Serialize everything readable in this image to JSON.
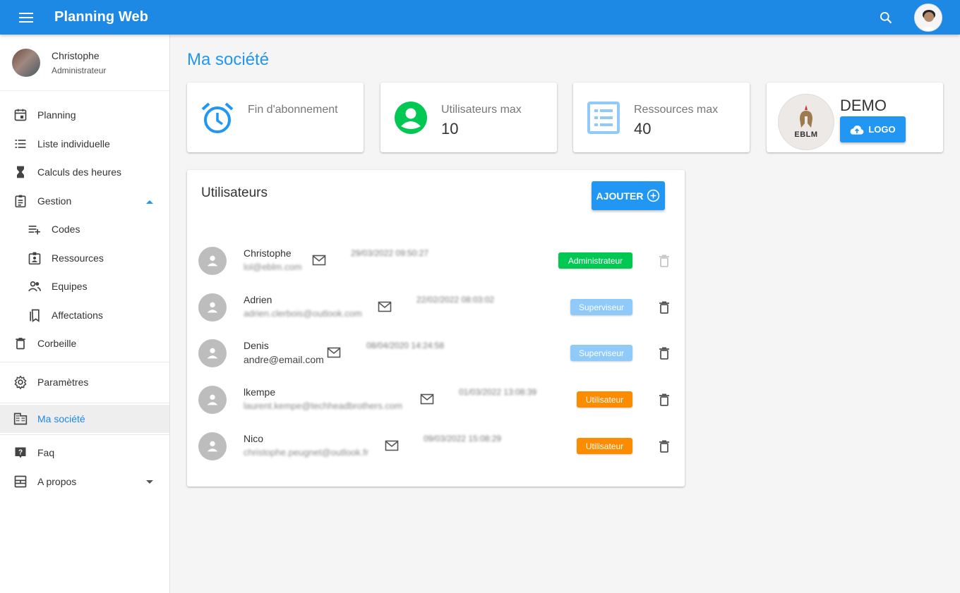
{
  "app": {
    "title": "Planning Web"
  },
  "sidebar": {
    "user": {
      "name": "Christophe",
      "role": "Administrateur"
    },
    "items": [
      {
        "label": "Planning",
        "icon": "calendar-icon"
      },
      {
        "label": "Liste individuelle",
        "icon": "list-icon"
      },
      {
        "label": "Calculs des heures",
        "icon": "hourglass-icon"
      },
      {
        "label": "Gestion",
        "icon": "clipboard-icon"
      },
      {
        "label": "Codes",
        "icon": "playlist-add-icon"
      },
      {
        "label": "Ressources",
        "icon": "badge-icon"
      },
      {
        "label": "Equipes",
        "icon": "people-icon"
      },
      {
        "label": "Affectations",
        "icon": "bookmarks-icon"
      },
      {
        "label": "Corbeille",
        "icon": "trash-icon"
      },
      {
        "label": "Paramètres",
        "icon": "gear-icon"
      },
      {
        "label": "Ma société",
        "icon": "building-icon"
      },
      {
        "label": "Faq",
        "icon": "help-icon"
      },
      {
        "label": "A propos",
        "icon": "dashboard-icon"
      }
    ]
  },
  "page": {
    "title": "Ma société"
  },
  "stats": {
    "subscription": {
      "label": "Fin d'abonnement",
      "value": ""
    },
    "users_max": {
      "label": "Utilisateurs max",
      "value": "10"
    },
    "resources_max": {
      "label": "Ressources max",
      "value": "40"
    }
  },
  "company": {
    "name": "DEMO",
    "logo_text": "EBLM",
    "logo_button": "LOGO"
  },
  "users": {
    "title": "Utilisateurs",
    "add_button": "AJOUTER",
    "rows": [
      {
        "name": "Christophe",
        "email": "lol@eblm.com",
        "date": "29/03/2022 09:50:27",
        "role": "Administrateur"
      },
      {
        "name": "Adrien",
        "email": "adrien.clerbois@outlook.com",
        "date": "22/02/2022 08:03:02",
        "role": "Superviseur"
      },
      {
        "name": "Denis",
        "email": "andre@email.com",
        "date": "08/04/2020 14:24:58",
        "role": "Superviseur"
      },
      {
        "name": "lkempe",
        "email": "laurent.kempe@techheadbrothers.com",
        "date": "01/03/2022 13:08:39",
        "role": "Utilisateur"
      },
      {
        "name": "Nico",
        "email": "christophe.peugnet@outlook.fr",
        "date": "09/03/2022 15:08:29",
        "role": "Utilisateur"
      }
    ]
  },
  "colors": {
    "primary": "#1e88e5",
    "accent": "#2196f3",
    "admin_badge": "#00c853",
    "supervisor_badge": "#90caf9",
    "user_badge": "#fb8c00"
  }
}
